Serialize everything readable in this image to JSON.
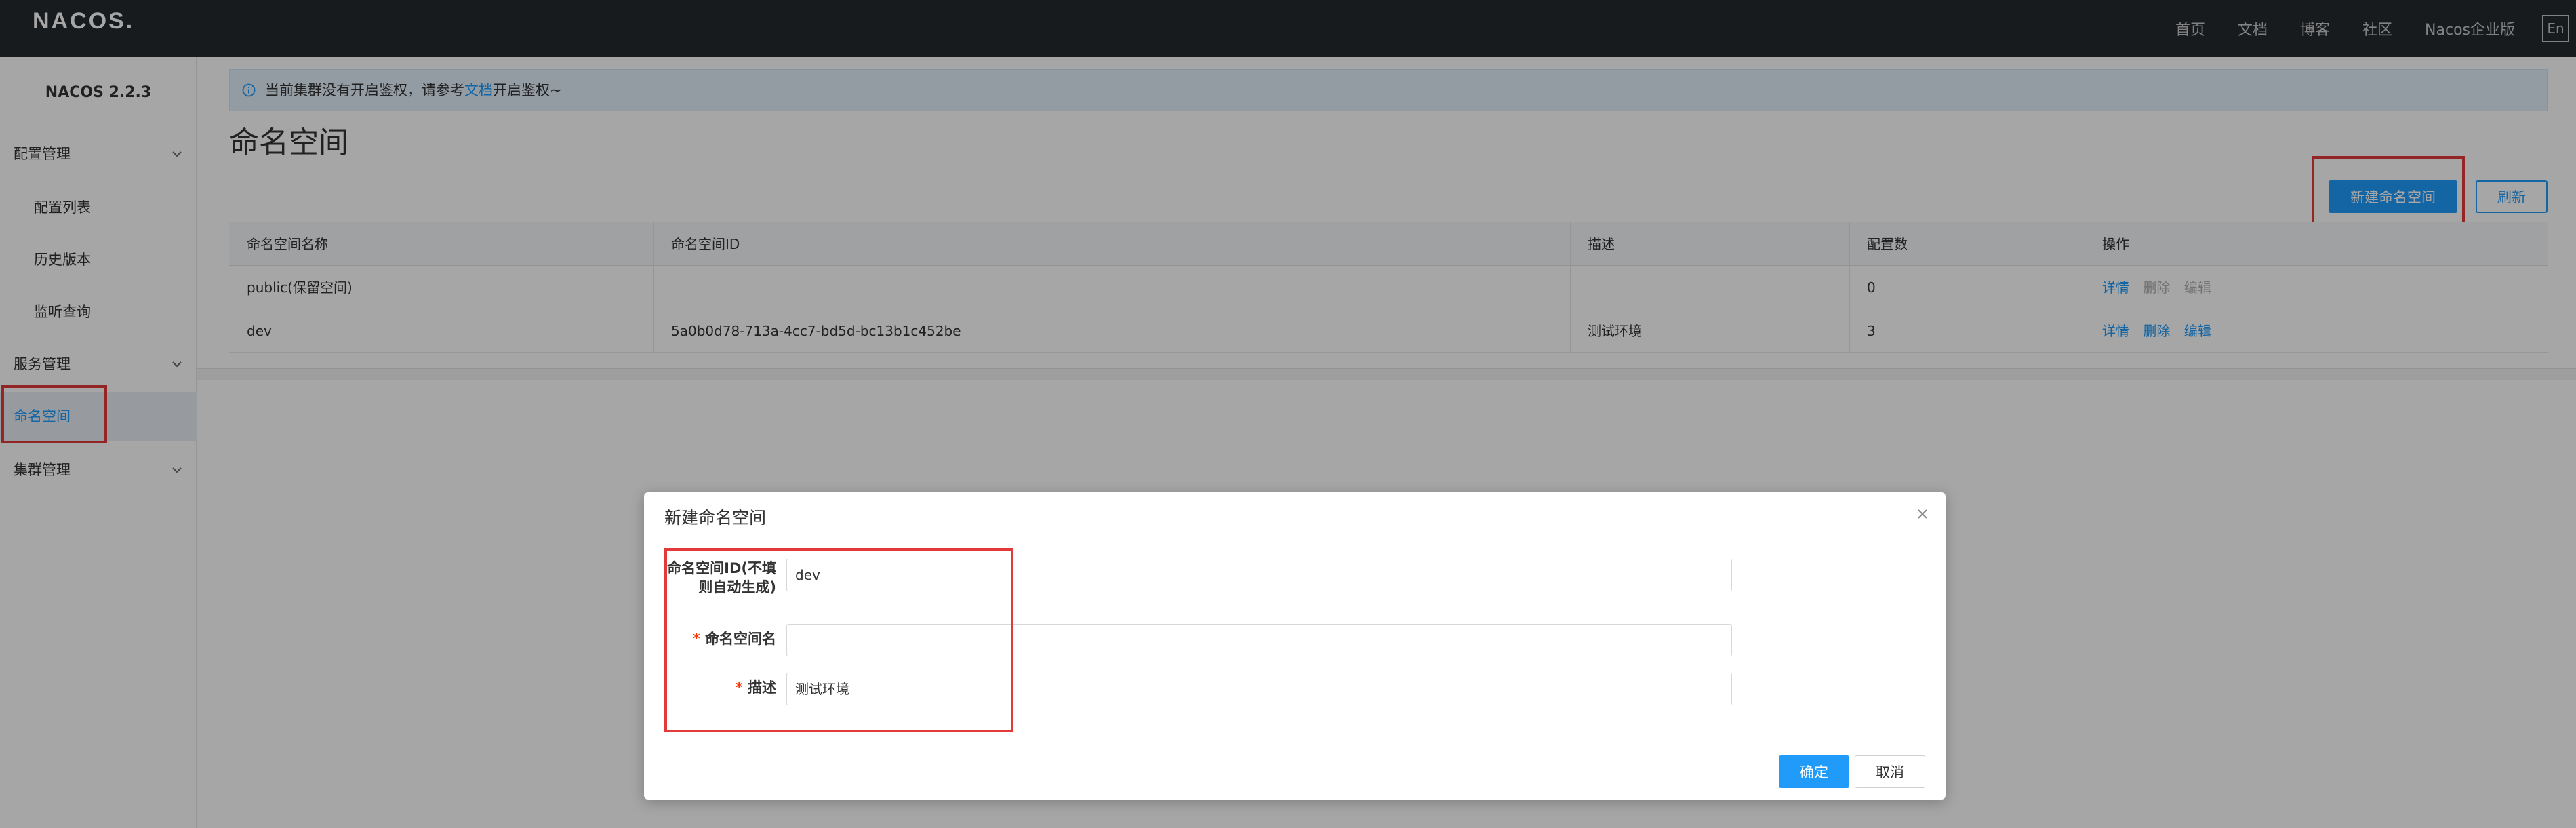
{
  "header": {
    "logo": "NACOS.",
    "nav": [
      "首页",
      "文档",
      "博客",
      "社区",
      "Nacos企业版"
    ],
    "lang_button": "En"
  },
  "sidebar": {
    "version": "NACOS 2.2.3",
    "groups": [
      {
        "label": "配置管理",
        "items": [
          "配置列表",
          "历史版本",
          "监听查询"
        ]
      },
      {
        "label": "服务管理"
      },
      {
        "label": "命名空间",
        "active": true
      },
      {
        "label": "集群管理"
      }
    ]
  },
  "notice": {
    "text_before": "当前集群没有开启鉴权，请参考",
    "link": "文档",
    "text_after": "开启鉴权~"
  },
  "page": {
    "title": "命名空间",
    "new_button": "新建命名空间",
    "refresh_button": "刷新"
  },
  "table": {
    "columns": [
      "命名空间名称",
      "命名空间ID",
      "描述",
      "配置数",
      "操作"
    ],
    "rows": [
      {
        "name": "public(保留空间)",
        "id": "",
        "desc": "",
        "count": "0",
        "actions": [
          "详情",
          "删除",
          "编辑"
        ]
      },
      {
        "name": "dev",
        "id": "5a0b0d78-713a-4cc7-bd5d-bc13b1c452be",
        "desc": "测试环境",
        "count": "3",
        "actions": [
          "详情",
          "删除",
          "编辑"
        ]
      }
    ]
  },
  "dialog": {
    "title": "新建命名空间",
    "fields": [
      {
        "label": "命名空间ID(不填则自动生成)",
        "label_line1": "命名空间ID(不填",
        "label_line2": "则自动生成)",
        "value": "dev"
      },
      {
        "label": "命名空间名",
        "required": true,
        "value": ""
      },
      {
        "label": "描述",
        "required": true,
        "value": "测试环境"
      }
    ],
    "confirm_button": "确定",
    "cancel_button": "取消"
  },
  "colors": {
    "topbar": "#252a2f",
    "accent": "#209bfa",
    "highlight_box": "#e23a3a",
    "required": "#ff3000"
  }
}
